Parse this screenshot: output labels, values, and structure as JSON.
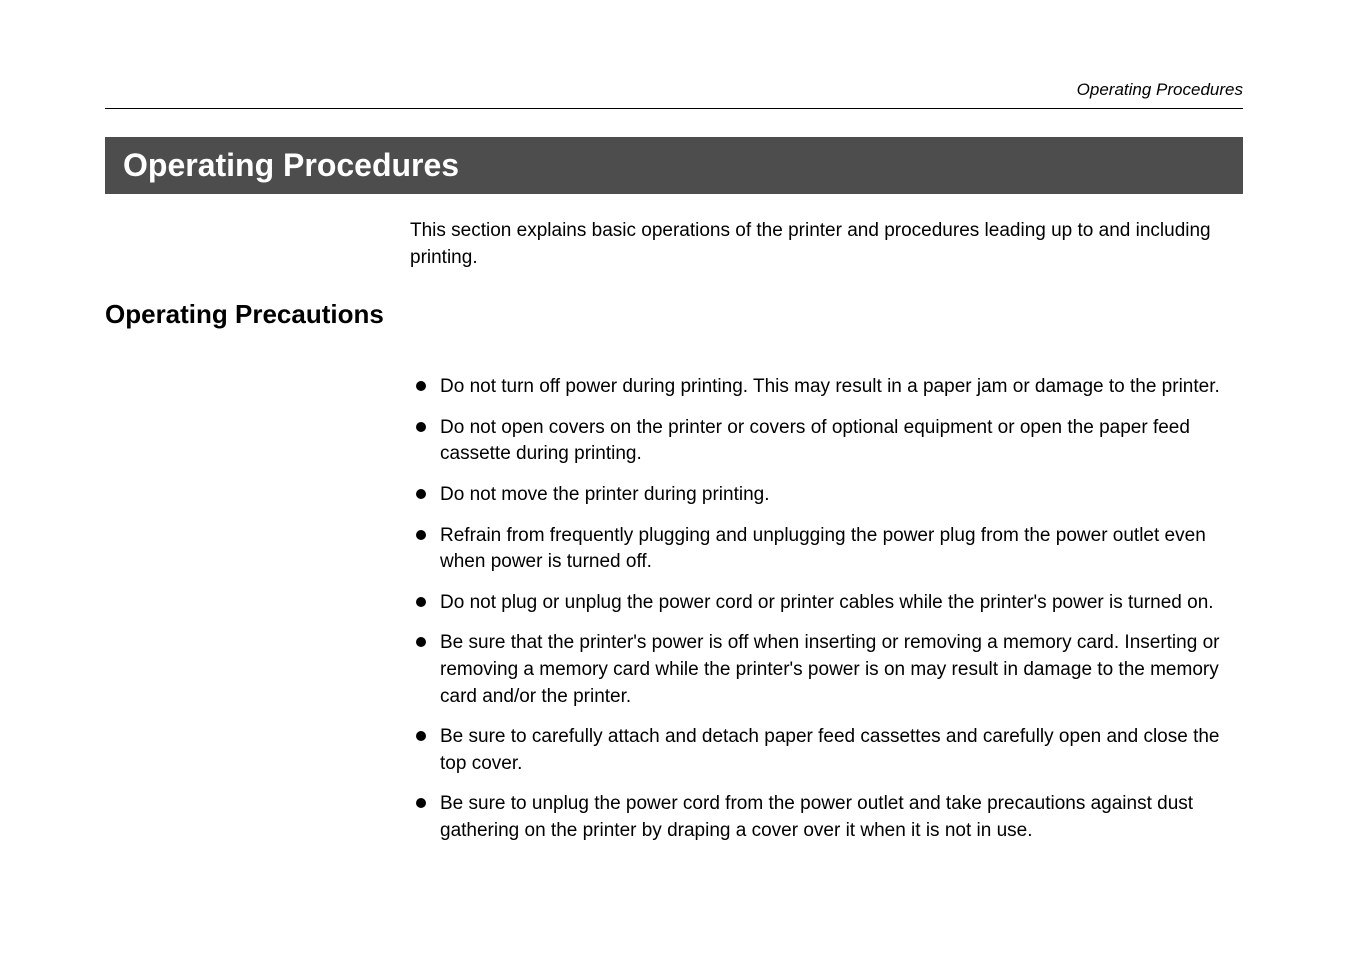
{
  "header": {
    "running_title": "Operating Procedures"
  },
  "title": "Operating Procedures",
  "intro": "This section explains basic operations of the printer and procedures leading up to and including printing.",
  "section_heading": "Operating Precautions",
  "bullets": [
    "Do not turn off power during printing.  This may result in a paper jam or damage to the printer.",
    "Do not open covers on the printer or covers of optional equipment or open the paper feed cassette during printing.",
    "Do not move the printer during printing.",
    "Refrain from frequently plugging and unplugging the power plug from the power outlet even when power is turned off.",
    "Do not plug or unplug the power cord or printer cables while the printer's power is turned on.",
    "Be sure that the printer's power is off when inserting or removing a memory card. Inserting or removing a memory card while the printer's power is on may result in damage to the memory card and/or the printer.",
    "Be sure to carefully attach and detach paper feed cassettes and carefully open and close the top cover.",
    "Be sure to unplug the power cord from the power outlet and take precautions against dust gathering on the printer by draping a cover over it when it is not in use."
  ]
}
